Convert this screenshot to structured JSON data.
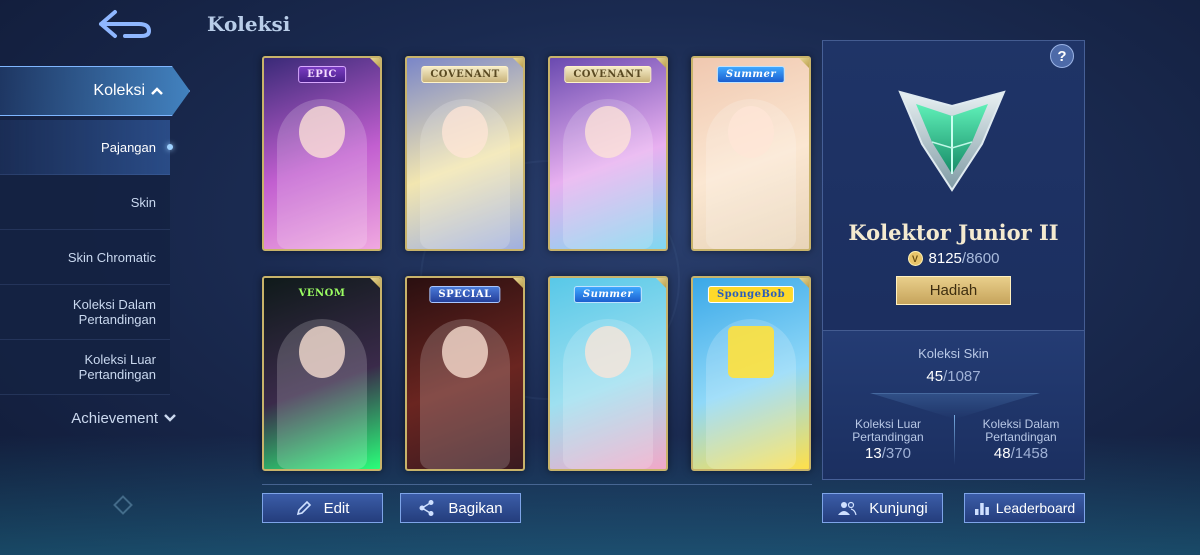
{
  "header": {
    "title": "Koleksi"
  },
  "sidebar": {
    "top_item": "Koleksi",
    "sub_items": [
      {
        "label": "Pajangan"
      },
      {
        "label": "Skin"
      },
      {
        "label": "Skin Chromatic"
      },
      {
        "label": "Koleksi Dalam\nPertandingan"
      },
      {
        "label": "Koleksi Luar\nPertandingan"
      }
    ],
    "achievement": "Achievement"
  },
  "cards": [
    {
      "tag": "EPIC",
      "tag_style": "epic",
      "colors": [
        "#3a2a78",
        "#c25fd0",
        "#f0a8e0"
      ]
    },
    {
      "tag": "COVENANT",
      "tag_style": "cov",
      "colors": [
        "#7a86c8",
        "#f2e6b0",
        "#a0b0e0"
      ]
    },
    {
      "tag": "COVENANT",
      "tag_style": "cov",
      "colors": [
        "#6a4ab0",
        "#e8b0f0",
        "#80d8f0"
      ]
    },
    {
      "tag": "Summer",
      "tag_style": "summer",
      "colors": [
        "#f0c8b0",
        "#fbe7d2",
        "#e8d4b8"
      ]
    },
    {
      "tag": "VENOM",
      "tag_style": "venom",
      "colors": [
        "#0f1a1a",
        "#3a2a4a",
        "#2aff7a"
      ]
    },
    {
      "tag": "SPECIAL",
      "tag_style": "special",
      "colors": [
        "#2a0f10",
        "#6a2520",
        "#3a1a20"
      ]
    },
    {
      "tag": "Summer",
      "tag_style": "summer",
      "colors": [
        "#58c8e8",
        "#9ee0f0",
        "#f2a8c8"
      ]
    },
    {
      "tag": "SpongeBob",
      "tag_style": "sponge",
      "colors": [
        "#3aa8e8",
        "#8fd8f8",
        "#ffe04a"
      ]
    }
  ],
  "actions": {
    "edit": "Edit",
    "share": "Bagikan",
    "visit": "Kunjungi",
    "leaderboard": "Leaderboard"
  },
  "rank": {
    "title": "Kolektor Junior II",
    "points_current": "8125",
    "points_total": "/8600",
    "reward_button": "Hadiah"
  },
  "stats": {
    "skin_label": "Koleksi Skin",
    "skin_current": "45",
    "skin_total": "/1087",
    "outside_label": "Koleksi Luar\nPertandingan",
    "outside_current": "13",
    "outside_total": "/370",
    "inside_label": "Koleksi Dalam\nPertandingan",
    "inside_current": "48",
    "inside_total": "/1458"
  },
  "help_icon": "?",
  "colors": {
    "accent_blue": "#3b5da8",
    "gold": "#c8b36a",
    "rank_green": "#2fb88a"
  }
}
